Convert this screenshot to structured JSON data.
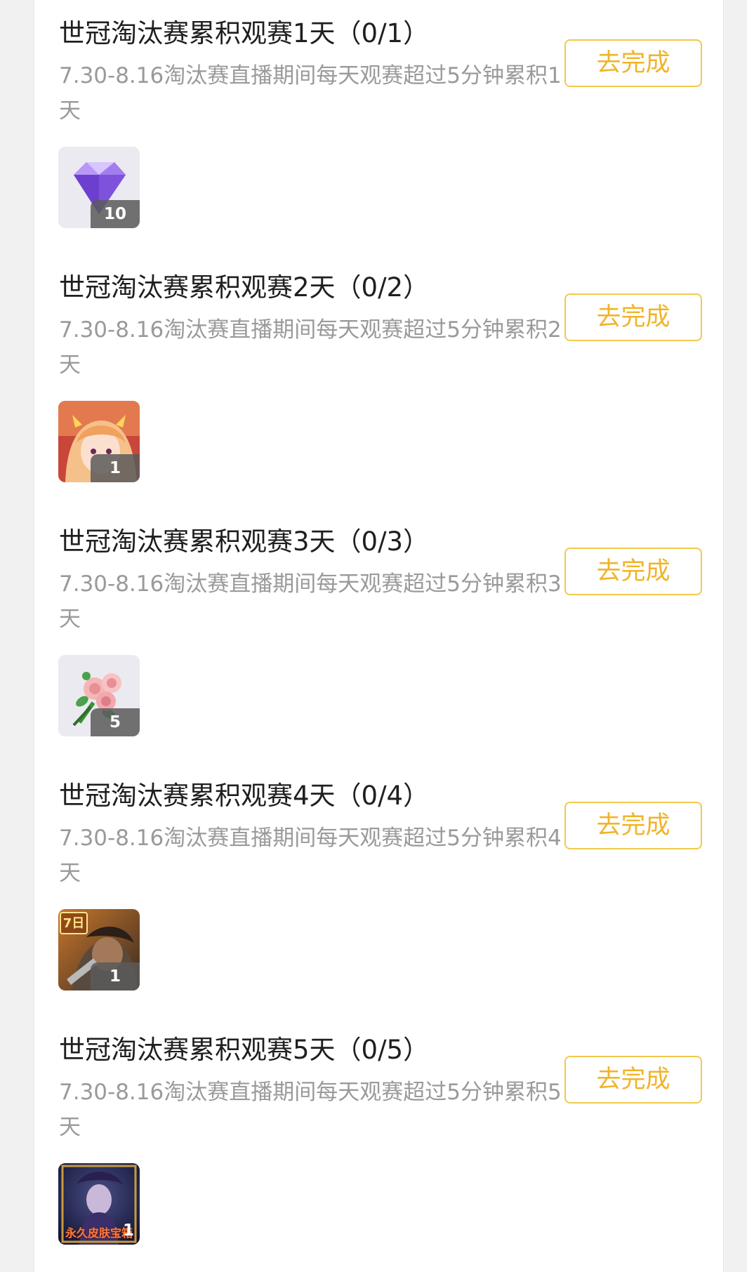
{
  "tasks": [
    {
      "title": "世冠淘汰赛累积观赛1天（0/1）",
      "description": "7.30-8.16淘汰赛直播期间每天观赛超过5分钟累积1天",
      "button_label": "去完成",
      "reward": {
        "icon": "crystal-gem-icon",
        "count": "10"
      }
    },
    {
      "title": "世冠淘汰赛累积观赛2天（0/2）",
      "description": "7.30-8.16淘汰赛直播期间每天观赛超过5分钟累积2天",
      "button_label": "去完成",
      "reward": {
        "icon": "hero-portrait-icon",
        "count": "1"
      }
    },
    {
      "title": "世冠淘汰赛累积观赛3天（0/3）",
      "description": "7.30-8.16淘汰赛直播期间每天观赛超过5分钟累积3天",
      "button_label": "去完成",
      "reward": {
        "icon": "rose-bouquet-icon",
        "count": "5"
      }
    },
    {
      "title": "世冠淘汰赛累积观赛4天（0/4）",
      "description": "7.30-8.16淘汰赛直播期间每天观赛超过5分钟累积4天",
      "button_label": "去完成",
      "reward": {
        "icon": "hero-skin-trial-icon",
        "count": "1",
        "tag": "7日"
      }
    },
    {
      "title": "世冠淘汰赛累积观赛5天（0/5）",
      "description": "7.30-8.16淘汰赛直播期间每天观赛超过5分钟累积5天",
      "button_label": "去完成",
      "reward": {
        "icon": "skin-box-icon",
        "count": "1",
        "label": "永久皮肤宝箱"
      }
    }
  ],
  "colors": {
    "accent": "#f2c94c",
    "button_text": "#f0b429",
    "title": "#1f1f1f",
    "description": "#9a9a9a"
  }
}
